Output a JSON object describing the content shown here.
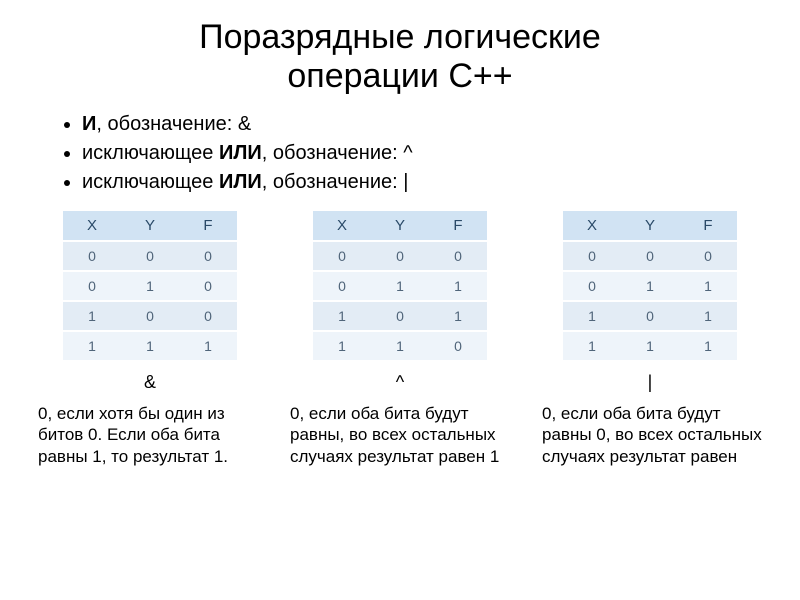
{
  "title_line1": "Поразрядные логические",
  "title_line2": "операции C++",
  "bullets": [
    {
      "prefix": "",
      "bold": "И",
      "rest": ", обозначение: &"
    },
    {
      "prefix": "исключающее ",
      "bold": "ИЛИ",
      "rest": ", обозначение:  ^"
    },
    {
      "prefix": "исключающее ",
      "bold": "ИЛИ",
      "rest": ", обозначение:  |"
    }
  ],
  "headers": {
    "x": "X",
    "y": "Y",
    "f": "F"
  },
  "chart_data": [
    {
      "type": "table",
      "title": "&",
      "categories": [
        "X",
        "Y",
        "F"
      ],
      "rows": [
        [
          0,
          0,
          0
        ],
        [
          0,
          1,
          0
        ],
        [
          1,
          0,
          0
        ],
        [
          1,
          1,
          1
        ]
      ]
    },
    {
      "type": "table",
      "title": "^",
      "categories": [
        "X",
        "Y",
        "F"
      ],
      "rows": [
        [
          0,
          0,
          0
        ],
        [
          0,
          1,
          1
        ],
        [
          1,
          0,
          1
        ],
        [
          1,
          1,
          0
        ]
      ]
    },
    {
      "type": "table",
      "title": "|",
      "categories": [
        "X",
        "Y",
        "F"
      ],
      "rows": [
        [
          0,
          0,
          0
        ],
        [
          0,
          1,
          1
        ],
        [
          1,
          0,
          1
        ],
        [
          1,
          1,
          1
        ]
      ]
    }
  ],
  "ops": {
    "and": "&",
    "xor": "^",
    "or": "|"
  },
  "descs": {
    "and": "0, если хотя бы один из битов 0. Если оба бита равны 1, то результат 1.",
    "xor": "0, если оба бита будут равны, во всех остальных случаях результат равен 1",
    "or": "0, если оба бита будут равны 0, во всех остальных случаях результат равен"
  }
}
